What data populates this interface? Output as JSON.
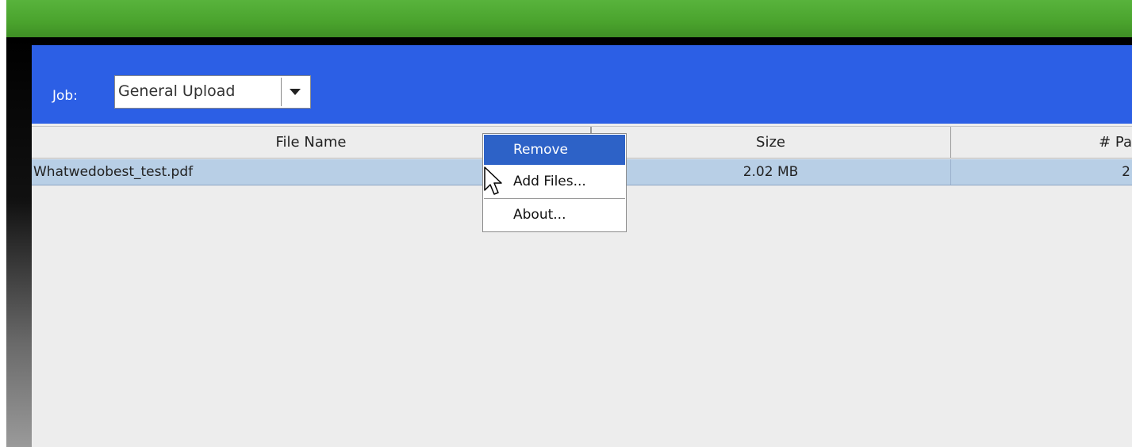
{
  "job": {
    "label": "Job:",
    "selected": "General Upload"
  },
  "table": {
    "columns": [
      "File Name",
      "",
      "Size",
      "# Pa"
    ],
    "rows": [
      [
        "Whatwedobest_test.pdf",
        "",
        "2.02 MB",
        "2"
      ]
    ]
  },
  "context_menu": {
    "items": [
      {
        "label": "Remove",
        "highlighted": true
      },
      {
        "label": "Add Files..."
      },
      {
        "label": "About..."
      }
    ]
  },
  "colors": {
    "banner_green": "#4aa32d",
    "panel_blue": "#2c5fe5",
    "selection_row": "#b8cfe6",
    "menu_highlight": "#2d62c7"
  },
  "icons": {
    "combo_arrow": "chevron-down-icon",
    "cursor": "mouse-pointer-icon"
  }
}
